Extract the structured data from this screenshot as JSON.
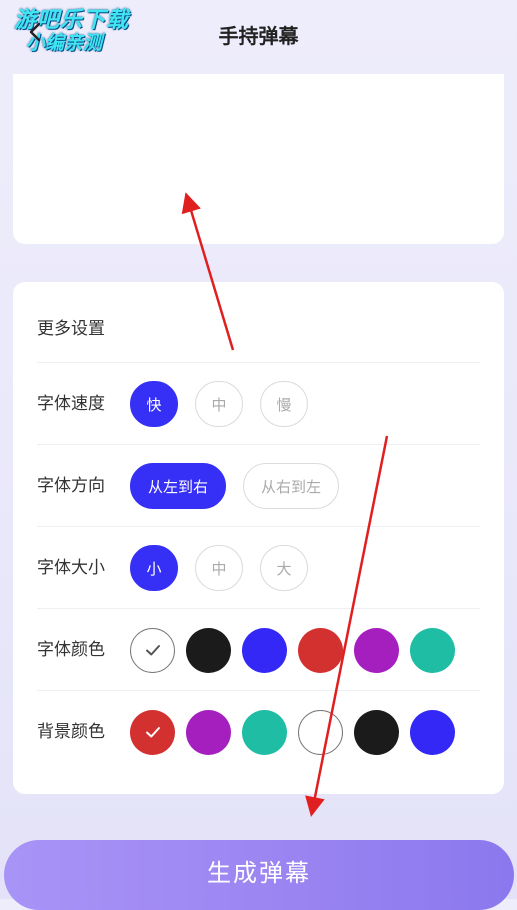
{
  "watermark": {
    "line1": "游吧乐下载",
    "line2": "小编亲测"
  },
  "header": {
    "title": "手持弹幕"
  },
  "settings": {
    "title": "更多设置",
    "speed": {
      "label": "字体速度",
      "options": [
        "快",
        "中",
        "慢"
      ],
      "selected": 0
    },
    "direction": {
      "label": "字体方向",
      "options": [
        "从左到右",
        "从右到左"
      ],
      "selected": 0
    },
    "size": {
      "label": "字体大小",
      "options": [
        "小",
        "中",
        "大"
      ],
      "selected": 0
    },
    "font_color": {
      "label": "字体颜色",
      "colors": [
        "#ffffff",
        "#1b1b1b",
        "#3328f5",
        "#d33030",
        "#a51fbf",
        "#1fbda3"
      ],
      "selected": 0
    },
    "bg_color": {
      "label": "背景颜色",
      "colors": [
        "#d33030",
        "#a51fbf",
        "#1fbda3",
        "#ffffff",
        "#1b1b1b",
        "#3328f5"
      ],
      "selected": 0
    }
  },
  "generate_button": {
    "label": "生成弹幕"
  },
  "colors": {
    "accent": "#3630f6",
    "button_gradient_start": "#a894f7",
    "button_gradient_end": "#8b78ee",
    "annotation_arrow": "#e02020"
  },
  "icons": {
    "back": "chevron-left-icon",
    "check": "check-icon"
  }
}
